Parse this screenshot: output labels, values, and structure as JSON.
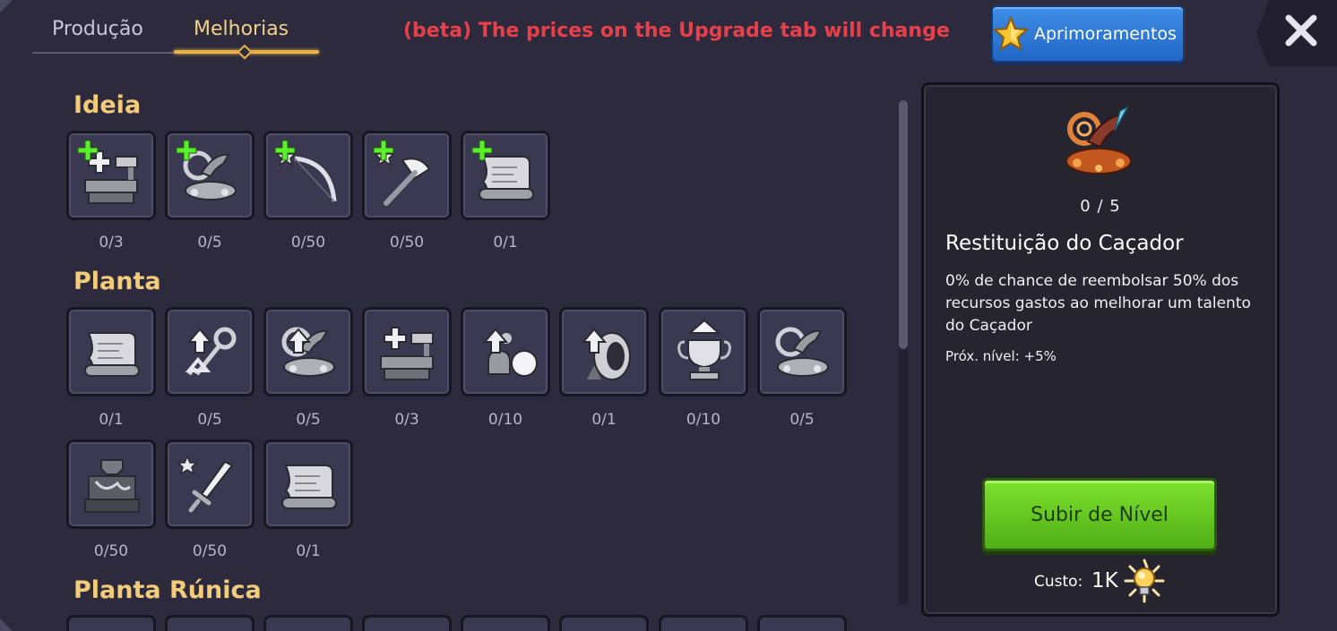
{
  "tabs": [
    {
      "label": "Produção",
      "active": false
    },
    {
      "label": "Melhorias",
      "active": true
    }
  ],
  "beta_notice": "(beta) The prices on the Upgrade tab will change",
  "enhancements_button": {
    "label": "Aprimoramentos",
    "icon": "star-icon"
  },
  "close_icon": "close-icon",
  "sections": [
    {
      "title": "Ideia",
      "items": [
        {
          "icon": "workbench-cross-icon",
          "count": "0/3",
          "plus": true
        },
        {
          "icon": "trophy-horn-icon",
          "count": "0/5",
          "plus": true
        },
        {
          "icon": "star-bow-icon",
          "count": "0/50",
          "plus": true
        },
        {
          "icon": "star-axe-icon",
          "count": "0/50",
          "plus": true
        },
        {
          "icon": "scroll-icon",
          "count": "0/1",
          "plus": true
        }
      ]
    },
    {
      "title": "Planta",
      "items": [
        {
          "icon": "scroll-icon",
          "count": "0/1"
        },
        {
          "icon": "up-arrow-key-icon",
          "count": "0/5"
        },
        {
          "icon": "up-arrow-horn-icon",
          "count": "0/5"
        },
        {
          "icon": "workbench-cross-icon",
          "count": "0/3"
        },
        {
          "icon": "up-arrow-potion-icon",
          "count": "0/10"
        },
        {
          "icon": "up-arrow-ring-icon",
          "count": "0/1"
        },
        {
          "icon": "trophy-cup-icon",
          "count": "0/10"
        },
        {
          "icon": "trophy-horn-icon",
          "count": "0/5"
        },
        {
          "icon": "anvil-icon",
          "count": "0/50"
        },
        {
          "icon": "star-sword-icon",
          "count": "0/50"
        },
        {
          "icon": "scroll-icon",
          "count": "0/1"
        }
      ]
    },
    {
      "title": "Planta Rúnica",
      "items": []
    }
  ],
  "detail": {
    "icon": "hunter-restitution-icon",
    "level": "0 / 5",
    "title": "Restituição do Caçador",
    "description": "0% de chance de reembolsar 50% dos recursos gastos ao melhorar um talento do Caçador",
    "next_level": "Próx. nível:  +5%",
    "button_label": "Subir de Nível",
    "cost_label": "Custo:",
    "cost_value": "1K",
    "cost_icon": "lightbulb-icon"
  },
  "colors": {
    "background": "#2c2a3c",
    "section_title": "#f2cc7a",
    "beta_notice": "#e8404a",
    "upgrade_button": "#6acb24",
    "enhancements_button": "#2f7ad6"
  }
}
